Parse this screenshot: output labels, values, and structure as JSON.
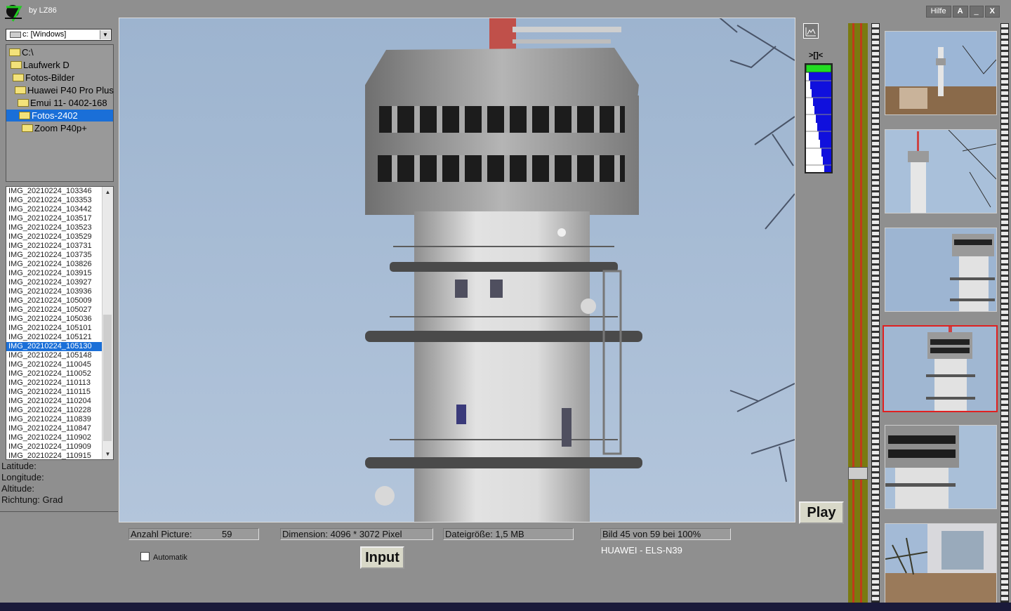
{
  "app": {
    "byline": "by LZ86",
    "buttons": {
      "help": "Hilfe",
      "a": "A",
      "minimize": "_",
      "close": "X"
    }
  },
  "drive": {
    "label": "c: [Windows]"
  },
  "tree": [
    {
      "label": "C:\\",
      "selected": false
    },
    {
      "label": "Laufwerk  D",
      "selected": false
    },
    {
      "label": "Fotos-Bilder",
      "selected": false
    },
    {
      "label": "Huawei P40 Pro Plus",
      "selected": false
    },
    {
      "label": "Emui 11- 0402-168",
      "selected": false
    },
    {
      "label": "Fotos-2402",
      "selected": true
    },
    {
      "label": "Zoom P40p+",
      "selected": false
    }
  ],
  "files": [
    "IMG_20210224_103346",
    "IMG_20210224_103353",
    "IMG_20210224_103442",
    "IMG_20210224_103517",
    "IMG_20210224_103523",
    "IMG_20210224_103529",
    "IMG_20210224_103731",
    "IMG_20210224_103735",
    "IMG_20210224_103826",
    "IMG_20210224_103915",
    "IMG_20210224_103927",
    "IMG_20210224_103936",
    "IMG_20210224_105009",
    "IMG_20210224_105027",
    "IMG_20210224_105036",
    "IMG_20210224_105101",
    "IMG_20210224_105121",
    "IMG_20210224_105130",
    "IMG_20210224_105148",
    "IMG_20210224_110045",
    "IMG_20210224_110052",
    "IMG_20210224_110113",
    "IMG_20210224_110115",
    "IMG_20210224_110204",
    "IMG_20210224_110228",
    "IMG_20210224_110839",
    "IMG_20210224_110847",
    "IMG_20210224_110902",
    "IMG_20210224_110909",
    "IMG_20210224_110915"
  ],
  "selected_file": "IMG_20210224_105130",
  "gps": {
    "latitude": "Latitude:",
    "longitude": "Longitude:",
    "altitude": "Altitude:",
    "direction": "Richtung: Grad"
  },
  "level_icon": ">[]<",
  "status": {
    "count_label": "Anzahl Picture:",
    "count_value": "59",
    "dimension": "Dimension: 4096 * 3072 Pixel",
    "filesize": "Dateigröße: 1,5 MB",
    "picture": "Bild  45 von 59 bei 100%",
    "camera": "HUAWEI - ELS-N39"
  },
  "controls": {
    "automatic": "Automatik",
    "input": "Input",
    "play": "Play"
  },
  "colors": {
    "selection": "#1a6fd8",
    "thumb_selected": "#e02020",
    "level_green": "#22dd22",
    "level_blue": "#1010dd"
  },
  "thumbnails": [
    {
      "icon": "city-tower-thumbnail"
    },
    {
      "icon": "tower-trees-thumbnail"
    },
    {
      "icon": "tower-top-thumbnail"
    },
    {
      "icon": "tower-zoom-thumbnail",
      "selected": true
    },
    {
      "icon": "tower-closeup-thumbnail"
    },
    {
      "icon": "building-park-thumbnail"
    }
  ]
}
